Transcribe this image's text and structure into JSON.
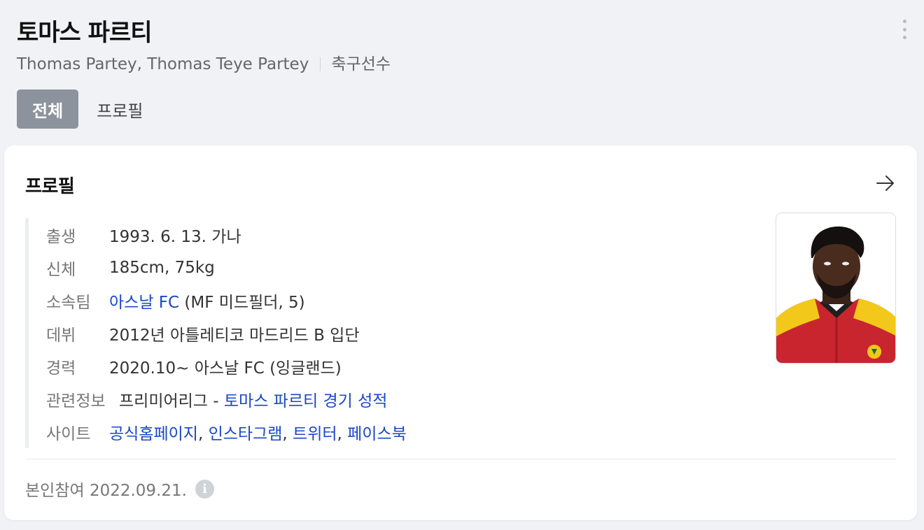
{
  "header": {
    "title": "토마스 파르티",
    "names": "Thomas Partey, Thomas Teye Partey",
    "category": "축구선수",
    "more_icon": "more-vertical-icon"
  },
  "tabs": [
    {
      "label": "전체",
      "active": true
    },
    {
      "label": "프로필",
      "active": false
    }
  ],
  "profile": {
    "title": "프로필",
    "arrow_icon": "arrow-right-icon",
    "rows": {
      "birth": {
        "label": "출생",
        "value": "1993. 6. 13. 가나"
      },
      "body": {
        "label": "신체",
        "value": "185cm, 75kg"
      },
      "team": {
        "label": "소속팀",
        "link": "아스날 FC",
        "value": "(MF 미드필더, 5)"
      },
      "debut": {
        "label": "데뷔",
        "value": "2012년 아틀레티코 마드리드 B 입단"
      },
      "career": {
        "label": "경력",
        "value": "2020.10~ 아스날 FC (잉글랜드)"
      },
      "related": {
        "label": "관련정보",
        "value": "프리미어리그 -",
        "link": "토마스 파르티 경기 성적"
      },
      "sites": {
        "label": "사이트",
        "links": [
          "공식홈페이지",
          "인스타그램",
          "트위터",
          "페이스북"
        ],
        "separator": ","
      }
    },
    "footer": "본인참여 2022.09.21.",
    "info_icon": "info-icon",
    "colors": {
      "link": "#1a47c7",
      "tab_active_bg": "#8d939d",
      "page_bg": "#f0f2f6"
    }
  }
}
